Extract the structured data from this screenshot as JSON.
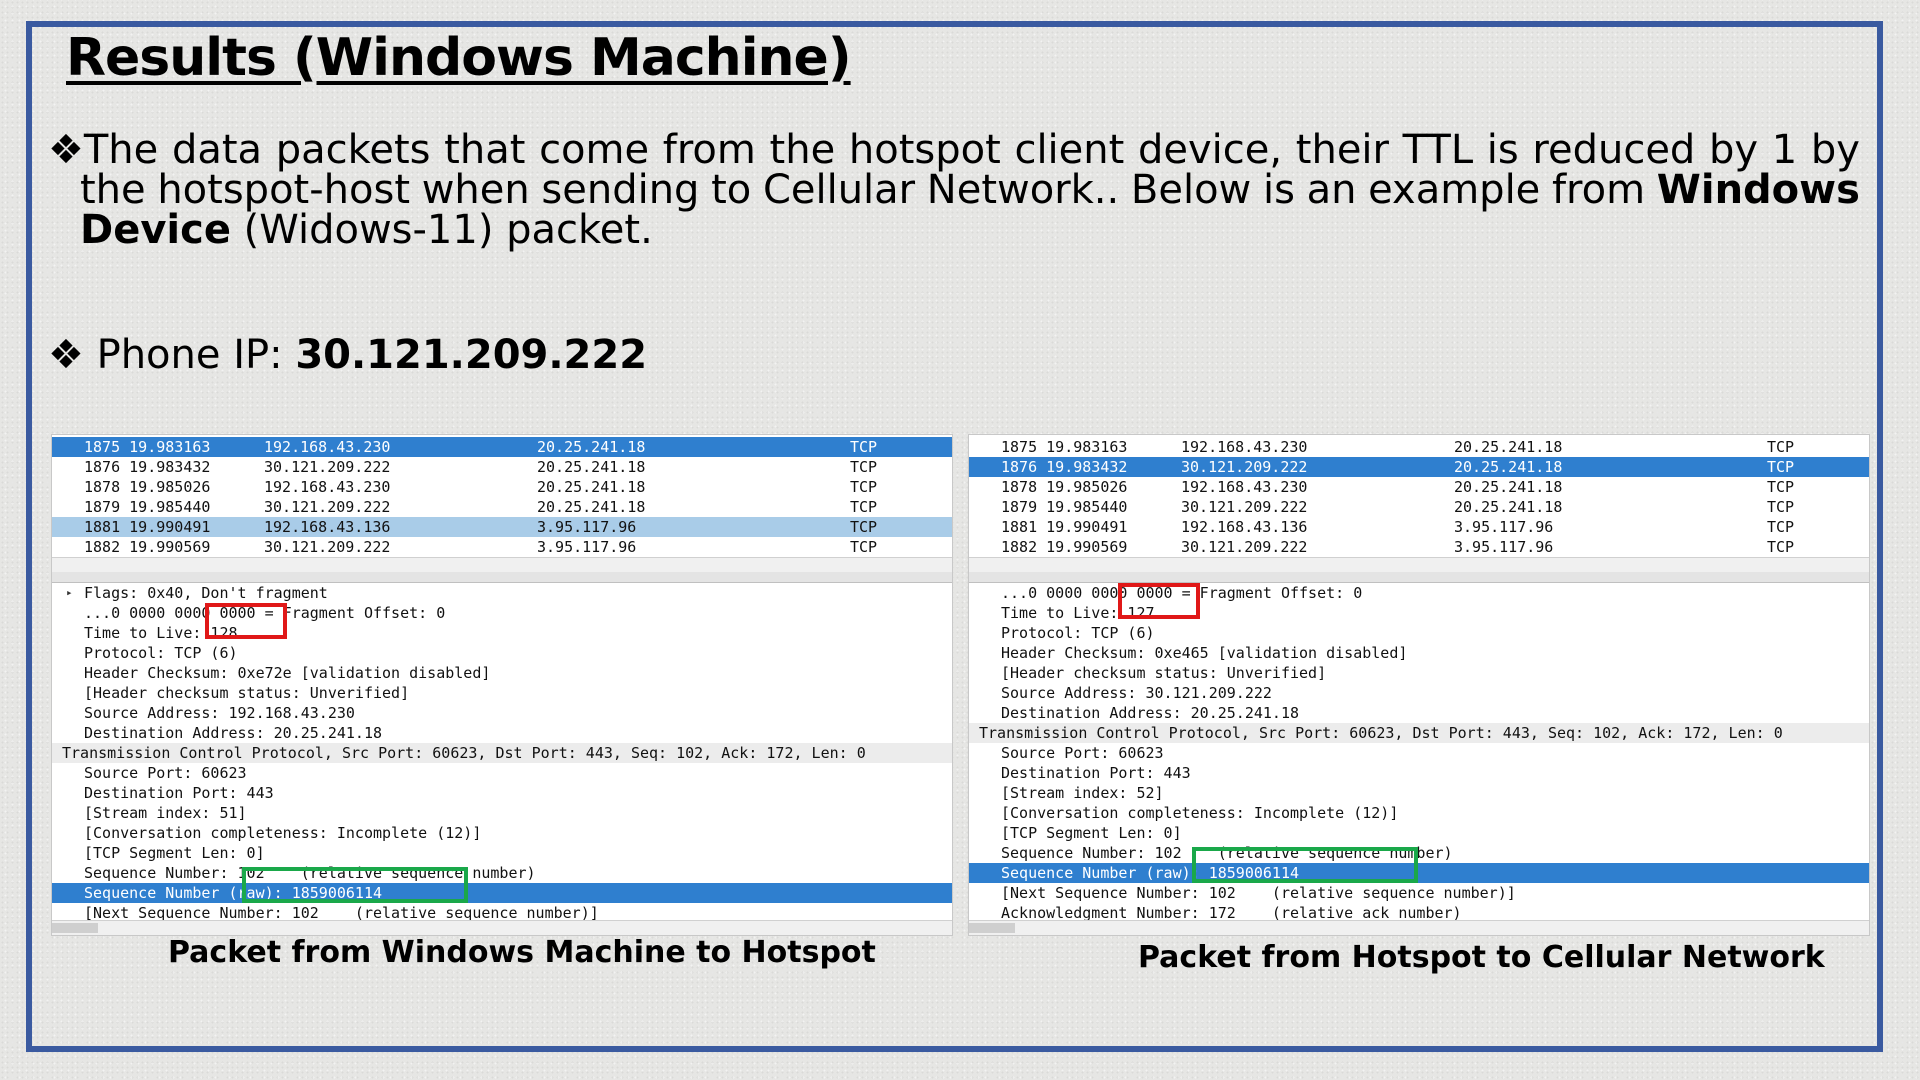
{
  "slide": {
    "title": "Results (Windows Machine)",
    "bullet1": {
      "line1_words": [
        "The",
        "data",
        "packets",
        "that",
        "come",
        "from",
        "the",
        "hotspot",
        "client",
        "device,",
        "their",
        "TTL",
        "is",
        "reduced",
        "by",
        "1",
        "by"
      ],
      "line2_words": [
        "the",
        "hotspot-host",
        "when",
        "sending",
        "to",
        "Cellular",
        "Network..",
        "Below",
        "is",
        "an",
        "example",
        "from"
      ],
      "line2_bold": "Windows",
      "line3_bold": "Device",
      "line3_rest": " (Widows-11) packet."
    },
    "bullet2": {
      "label": "Phone IP: ",
      "value": "30.121.209.222"
    }
  },
  "left_panel": {
    "packets": [
      {
        "no": "1875 19.983163",
        "src": "192.168.43.230",
        "dst": "20.25.241.18",
        "proto": "TCP"
      },
      {
        "no": "1876 19.983432",
        "src": "30.121.209.222",
        "dst": "20.25.241.18",
        "proto": "TCP"
      },
      {
        "no": "1878 19.985026",
        "src": "192.168.43.230",
        "dst": "20.25.241.18",
        "proto": "TCP"
      },
      {
        "no": "1879 19.985440",
        "src": "30.121.209.222",
        "dst": "20.25.241.18",
        "proto": "TCP"
      },
      {
        "no": "1881 19.990491",
        "src": "192.168.43.136",
        "dst": "3.95.117.96",
        "proto": "TCP"
      },
      {
        "no": "1882 19.990569",
        "src": "30.121.209.222",
        "dst": "3.95.117.96",
        "proto": "TCP"
      }
    ],
    "details": [
      "Flags: 0x40, Don't fragment",
      "...0 0000 0000 0000 = Fragment Offset: 0",
      "Time to Live: 128",
      "Protocol: TCP (6)",
      "Header Checksum: 0xe72e [validation disabled]",
      "[Header checksum status: Unverified]",
      "Source Address: 192.168.43.230",
      "Destination Address: 20.25.241.18",
      "Transmission Control Protocol, Src Port: 60623, Dst Port: 443, Seq: 102, Ack: 172, Len: 0",
      "Source Port: 60623",
      "Destination Port: 443",
      "[Stream index: 51]",
      "[Conversation completeness: Incomplete (12)]",
      "[TCP Segment Len: 0]",
      "Sequence Number: 102    (relative sequence number)",
      "Sequence Number (raw): 1859006114",
      "[Next Sequence Number: 102    (relative sequence number)]"
    ],
    "caption": "Packet from Windows Machine to Hotspot"
  },
  "right_panel": {
    "packets": [
      {
        "no": "1875 19.983163",
        "src": "192.168.43.230",
        "dst": "20.25.241.18",
        "proto": "TCP"
      },
      {
        "no": "1876 19.983432",
        "src": "30.121.209.222",
        "dst": "20.25.241.18",
        "proto": "TCP"
      },
      {
        "no": "1878 19.985026",
        "src": "192.168.43.230",
        "dst": "20.25.241.18",
        "proto": "TCP"
      },
      {
        "no": "1879 19.985440",
        "src": "30.121.209.222",
        "dst": "20.25.241.18",
        "proto": "TCP"
      },
      {
        "no": "1881 19.990491",
        "src": "192.168.43.136",
        "dst": "3.95.117.96",
        "proto": "TCP"
      },
      {
        "no": "1882 19.990569",
        "src": "30.121.209.222",
        "dst": "3.95.117.96",
        "proto": "TCP"
      }
    ],
    "details": [
      "...0 0000 0000 0000 = Fragment Offset: 0",
      "Time to Live: 127",
      "Protocol: TCP (6)",
      "Header Checksum: 0xe465 [validation disabled]",
      "[Header checksum status: Unverified]",
      "Source Address: 30.121.209.222",
      "Destination Address: 20.25.241.18",
      "Transmission Control Protocol, Src Port: 60623, Dst Port: 443, Seq: 102, Ack: 172, Len: 0",
      "Source Port: 60623",
      "Destination Port: 443",
      "[Stream index: 52]",
      "[Conversation completeness: Incomplete (12)]",
      "[TCP Segment Len: 0]",
      "Sequence Number: 102    (relative sequence number)",
      "Sequence Number (raw): 1859006114",
      "[Next Sequence Number: 102    (relative sequence number)]",
      "Acknowledgment Number: 172    (relative ack number)"
    ],
    "caption": "Packet from Hotspot to Cellular Network"
  },
  "colors": {
    "frame": "#3a5aa0",
    "selection": "#2f7fcf",
    "secondary_selection": "#a9cce8",
    "ttl_box": "#e01818",
    "seq_box": "#1aa84a"
  }
}
